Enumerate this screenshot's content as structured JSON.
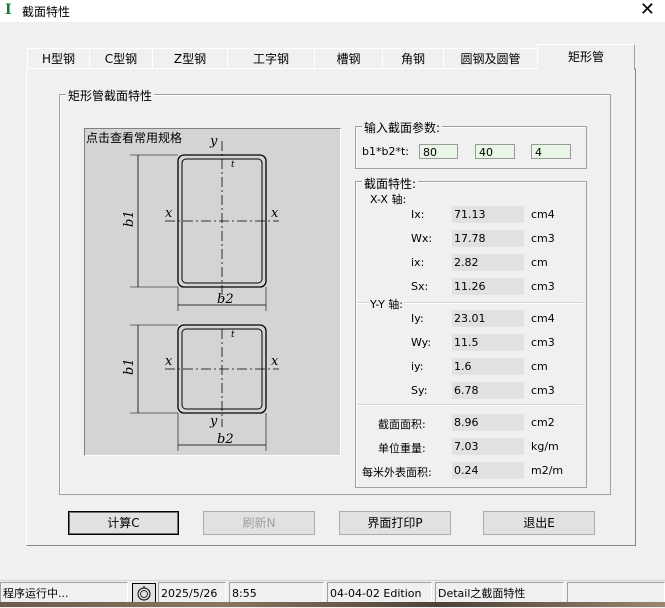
{
  "window": {
    "title": "截面特性",
    "close_glyph": "✕"
  },
  "tabs": [
    {
      "label": "H型钢",
      "active": false
    },
    {
      "label": "C型钢",
      "active": false
    },
    {
      "label": "Z型钢",
      "active": false
    },
    {
      "label": "工字钢",
      "active": false
    },
    {
      "label": "槽钢",
      "active": false
    },
    {
      "label": "角钢",
      "active": false
    },
    {
      "label": "圆钢及圆管",
      "active": false
    },
    {
      "label": "矩形管",
      "active": true
    }
  ],
  "main_group": {
    "title": "矩形管截面特性"
  },
  "picture": {
    "hint": "点击查看常用规格",
    "labels": {
      "y": "y",
      "x": "x",
      "t": "t",
      "b1": "b1",
      "b2": "b2"
    }
  },
  "input_group": {
    "title": "输入截面参数:",
    "label": "b1*b2*t:",
    "b1": "80",
    "b2": "40",
    "t": "4"
  },
  "props_group": {
    "title": "截面特性:",
    "xx_axis": "X-X 轴:",
    "yy_axis": "Y-Y 轴:",
    "xx": [
      {
        "label": "Ix:",
        "value": "71.13",
        "unit": "cm4"
      },
      {
        "label": "Wx:",
        "value": "17.78",
        "unit": "cm3"
      },
      {
        "label": "ix:",
        "value": "2.82",
        "unit": "cm"
      },
      {
        "label": "Sx:",
        "value": "11.26",
        "unit": "cm3"
      }
    ],
    "yy": [
      {
        "label": "Iy:",
        "value": "23.01",
        "unit": "cm4"
      },
      {
        "label": "Wy:",
        "value": "11.5",
        "unit": "cm3"
      },
      {
        "label": "iy:",
        "value": "1.6",
        "unit": "cm"
      },
      {
        "label": "Sy:",
        "value": "6.78",
        "unit": "cm3"
      }
    ],
    "general": [
      {
        "label": "截面面积:",
        "value": "8.96",
        "unit": "cm2"
      },
      {
        "label": "单位重量:",
        "value": "7.03",
        "unit": "kg/m"
      },
      {
        "label": "每米外表面积:",
        "value": "0.24",
        "unit": "m2/m"
      }
    ]
  },
  "buttons": {
    "calc": "计算C",
    "refresh": "刷新N",
    "print": "界面打印P",
    "exit": "退出E"
  },
  "statusbar": {
    "status": "程序运行中...",
    "date": "2025/5/26",
    "time": "8:55",
    "edition": "04-04-02 Edition",
    "detail": "Detail之截面特性"
  },
  "colors": {
    "input_bg": "#e8f7e5",
    "value_bg": "#e1e1e1",
    "picture_bg": "#d4d4d4"
  }
}
